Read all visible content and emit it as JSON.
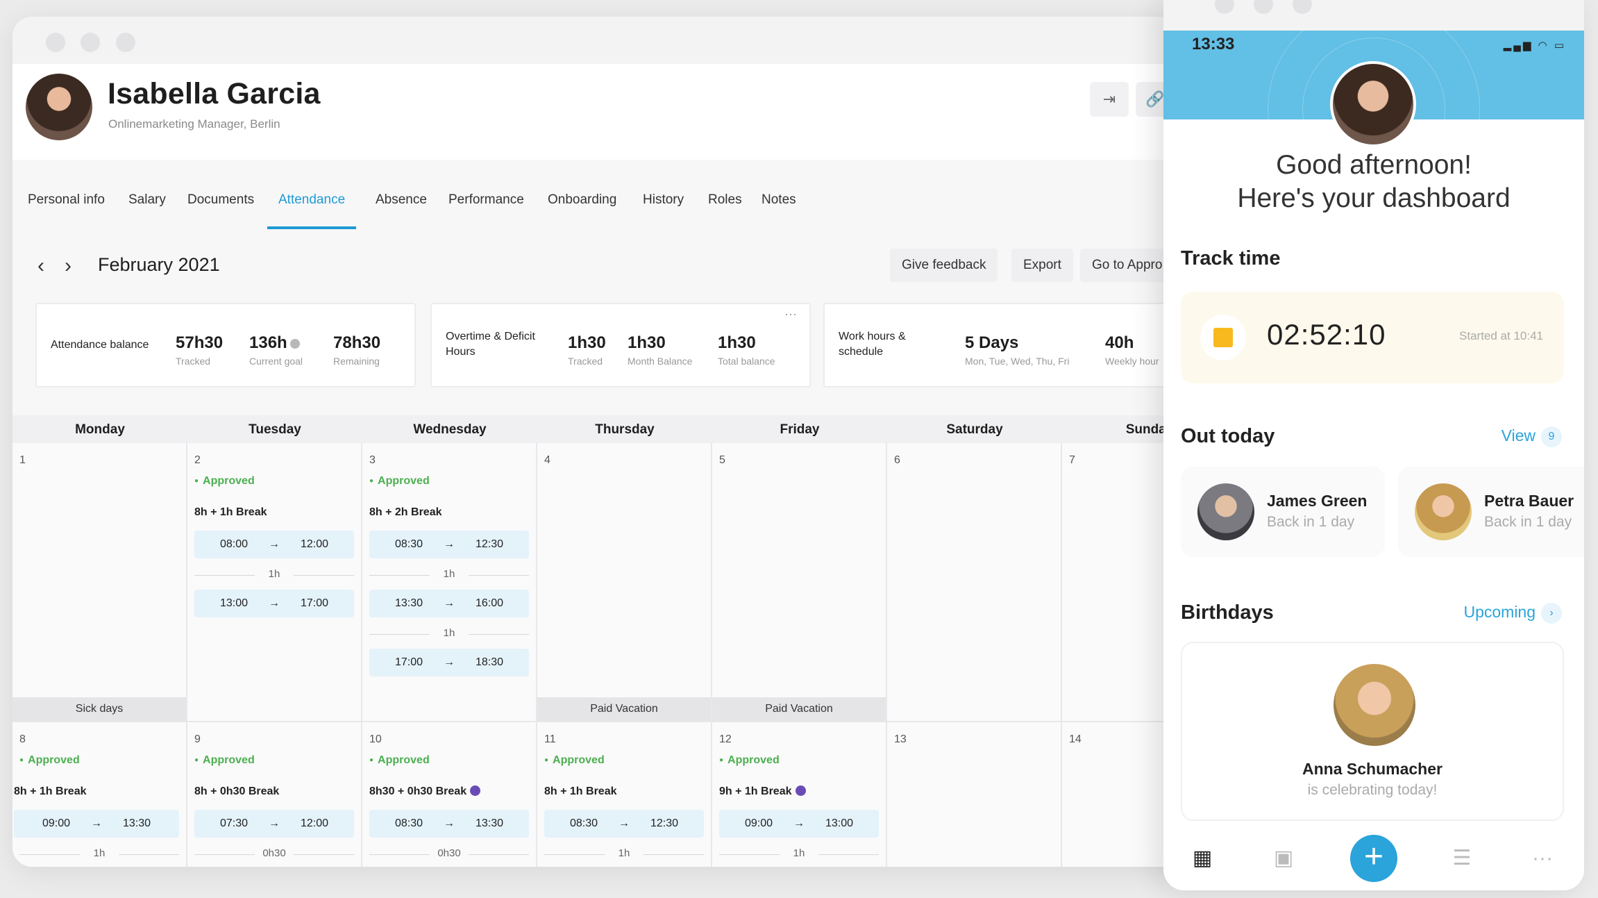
{
  "profile": {
    "name": "Isabella Garcia",
    "role": "Onlinemarketing Manager, Berlin"
  },
  "tabs": [
    "Personal info",
    "Salary",
    "Documents",
    "Attendance",
    "Absence",
    "Performance",
    "Onboarding",
    "History",
    "Roles",
    "Notes"
  ],
  "active_tab": "Attendance",
  "month": "February 2021",
  "toolbar": {
    "feedback": "Give feedback",
    "export": "Export",
    "approvals": "Go to Appro"
  },
  "stats": {
    "attendance": {
      "label": "Attendance balance",
      "items": [
        {
          "value": "57h30",
          "sub": "Tracked"
        },
        {
          "value": "136h",
          "sub": "Current goal"
        },
        {
          "value": "78h30",
          "sub": "Remaining"
        }
      ]
    },
    "overtime": {
      "label_line1": "Overtime & Deficit",
      "label_line2": "Hours",
      "items": [
        {
          "value": "1h30",
          "sub": "Tracked"
        },
        {
          "value": "1h30",
          "sub": "Month Balance"
        },
        {
          "value": "1h30",
          "sub": "Total balance"
        }
      ]
    },
    "workhours": {
      "label_line1": "Work hours &",
      "label_line2": "schedule",
      "items": [
        {
          "value": "5 Days",
          "sub": "Mon, Tue, Wed, Thu, Fri"
        },
        {
          "value": "40h",
          "sub": "Weekly hour"
        }
      ]
    }
  },
  "calendar": {
    "days": [
      "Monday",
      "Tuesday",
      "Wednesday",
      "Thursday",
      "Friday",
      "Saturday",
      "Sunday"
    ],
    "approved_label": "Approved",
    "arrow": "→",
    "week1": {
      "nums": [
        "1",
        "2",
        "3",
        "4",
        "5",
        "6",
        "7"
      ],
      "mon_footer": "Sick days",
      "tue": {
        "break": "8h + 1h Break",
        "s1_from": "08:00",
        "s1_to": "12:00",
        "gap": "1h",
        "s2_from": "13:00",
        "s2_to": "17:00"
      },
      "wed": {
        "break": "8h + 2h Break",
        "s1_from": "08:30",
        "s1_to": "12:30",
        "gap1": "1h",
        "s2_from": "13:30",
        "s2_to": "16:00",
        "gap2": "1h",
        "s3_from": "17:00",
        "s3_to": "18:30"
      },
      "thu_footer": "Paid Vacation",
      "fri_footer": "Paid Vacation"
    },
    "week2": {
      "nums": [
        "8",
        "9",
        "10",
        "11",
        "12",
        "13",
        "14"
      ],
      "mon": {
        "break": "8h + 1h Break",
        "from": "09:00",
        "to": "13:30",
        "gap": "1h"
      },
      "tue": {
        "break": "8h + 0h30 Break",
        "from": "07:30",
        "to": "12:00",
        "gap": "0h30"
      },
      "wed": {
        "break": "8h30 + 0h30 Break",
        "from": "08:30",
        "to": "13:30",
        "gap": "0h30"
      },
      "thu": {
        "break": "8h + 1h Break",
        "from": "08:30",
        "to": "12:30",
        "gap": "1h"
      },
      "fri": {
        "break": "9h + 1h Break",
        "from": "09:00",
        "to": "13:00",
        "gap": "1h"
      }
    }
  },
  "phone": {
    "time": "13:33",
    "greeting_line1": "Good afternoon!",
    "greeting_line2": "Here's your dashboard",
    "track": {
      "title": "Track time",
      "timer": "02:52:10",
      "started": "Started at 10:41"
    },
    "out": {
      "title": "Out today",
      "view": "View",
      "count": "9",
      "people": [
        {
          "name": "James Green",
          "sub": "Back in 1 day"
        },
        {
          "name": "Petra Bauer",
          "sub": "Back in 1 day"
        }
      ]
    },
    "birthdays": {
      "title": "Birthdays",
      "upcoming": "Upcoming",
      "name": "Anna Schumacher",
      "sub": "is celebrating today!"
    }
  },
  "colors": {
    "accent": "#1e9ad3",
    "approved": "#4caf50",
    "slot": "#e4f2fa",
    "timer_stop": "#f7b91e"
  },
  "icons": [
    "back-arrow-icon",
    "link-icon",
    "chevron-left-icon",
    "chevron-right-icon",
    "info-icon",
    "clock-icon",
    "dashboard-icon",
    "calendar-icon",
    "plus-icon",
    "people-icon",
    "more-icon"
  ]
}
